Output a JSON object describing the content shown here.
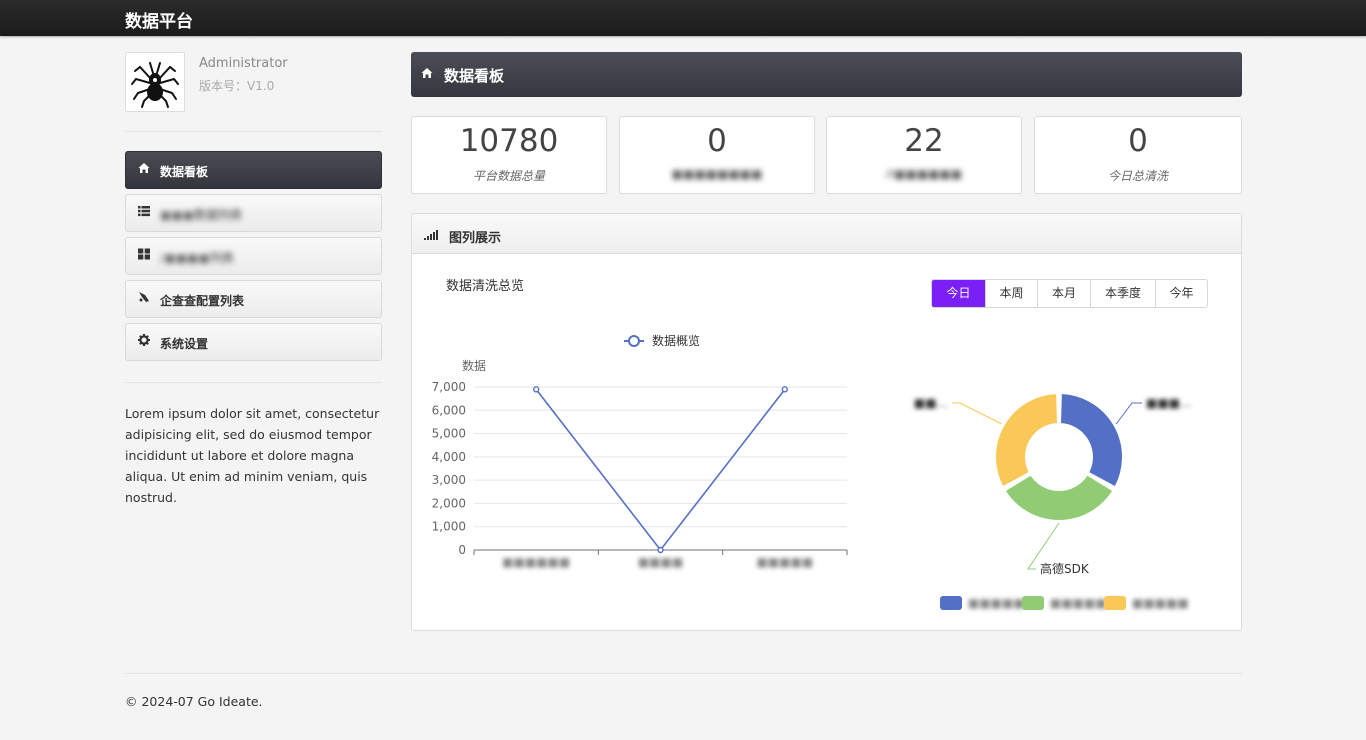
{
  "header": {
    "brand": "数据平台"
  },
  "profile": {
    "name": "Administrator",
    "version": "版本号：V1.0"
  },
  "nav": [
    {
      "label": "数据看板",
      "icon": "home-icon",
      "active": true
    },
    {
      "label": "■■■数据列表",
      "icon": "list-icon",
      "active": false
    },
    {
      "label": "/■■■■列表",
      "icon": "grid-icon",
      "active": false
    },
    {
      "label": "企查查配置列表",
      "icon": "rocket-icon",
      "active": false
    },
    {
      "label": "系统设置",
      "icon": "gear-icon",
      "active": false
    }
  ],
  "about": "Lorem ipsum dolor sit amet, consectetur adipisicing elit, sed do eiusmod tempor incididunt ut labore et dolore magna aliqua. Ut enim ad minim veniam, quis nostrud.",
  "dashboard": {
    "title": "数据看板"
  },
  "stats": [
    {
      "value": "10780",
      "caption": "平台数据总量"
    },
    {
      "value": "0",
      "caption": "■■■■■■■■"
    },
    {
      "value": "22",
      "caption": "A■■■■■■"
    },
    {
      "value": "0",
      "caption": "今日总清洗"
    }
  ],
  "chart_panel": {
    "title": "图列展示",
    "subtitle": "数据清洗总览",
    "tabs": [
      {
        "label": "今日",
        "active": true
      },
      {
        "label": "本周",
        "active": false
      },
      {
        "label": "本月",
        "active": false
      },
      {
        "label": "本季度",
        "active": false
      },
      {
        "label": "今年",
        "active": false
      }
    ]
  },
  "chart_data": [
    {
      "type": "line",
      "legend": [
        "数据概览"
      ],
      "ylabel": "数据",
      "categories": [
        "■■■■■■",
        "■■■■",
        "■■■■■"
      ],
      "series": [
        {
          "name": "数据概览",
          "values": [
            6900,
            0,
            6900
          ]
        }
      ],
      "ylim": [
        0,
        7000
      ],
      "yticks": [
        "0",
        "1,000",
        "2,000",
        "3,000",
        "4,000",
        "5,000",
        "6,000",
        "7,000"
      ],
      "color": "#5470c6",
      "grid": true
    },
    {
      "type": "pie",
      "donut": true,
      "slices": [
        {
          "label": "■■■...",
          "value": 33.3,
          "color": "#5470c6"
        },
        {
          "label": "高德SDK",
          "value": 33.3,
          "color": "#91cc75"
        },
        {
          "label": "■■...",
          "value": 33.3,
          "color": "#fac858"
        }
      ],
      "legend": [
        "■■■■■",
        "■■■■■",
        "■■■■■"
      ],
      "legend_position": "bottom"
    }
  ],
  "footer": {
    "text": "© 2024-07 Go Ideate."
  }
}
